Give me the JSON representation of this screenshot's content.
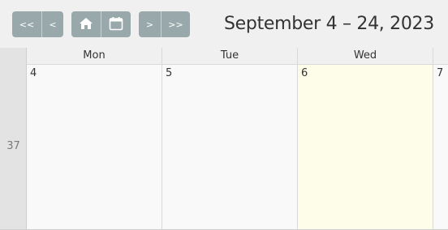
{
  "toolbar": {
    "prev_far_label": "<<",
    "prev_label": "<",
    "home_icon": "home-icon",
    "calendar_icon": "calendar-icon",
    "next_label": ">",
    "next_far_label": ">>",
    "title": "September 4 – 24, 2023"
  },
  "week": {
    "number": "37"
  },
  "columns": [
    {
      "header": "Mon",
      "day": "4"
    },
    {
      "header": "Tue",
      "day": "5"
    },
    {
      "header": "Wed",
      "day": "6"
    },
    {
      "header": "",
      "day": "7"
    }
  ],
  "colors": {
    "button": "#99a9ab",
    "toolbar_bg": "#f0f0f0",
    "today_bg": "#fdfde9",
    "cell_bg": "#f9f9f9",
    "week_col_bg": "#e3e3e3"
  }
}
